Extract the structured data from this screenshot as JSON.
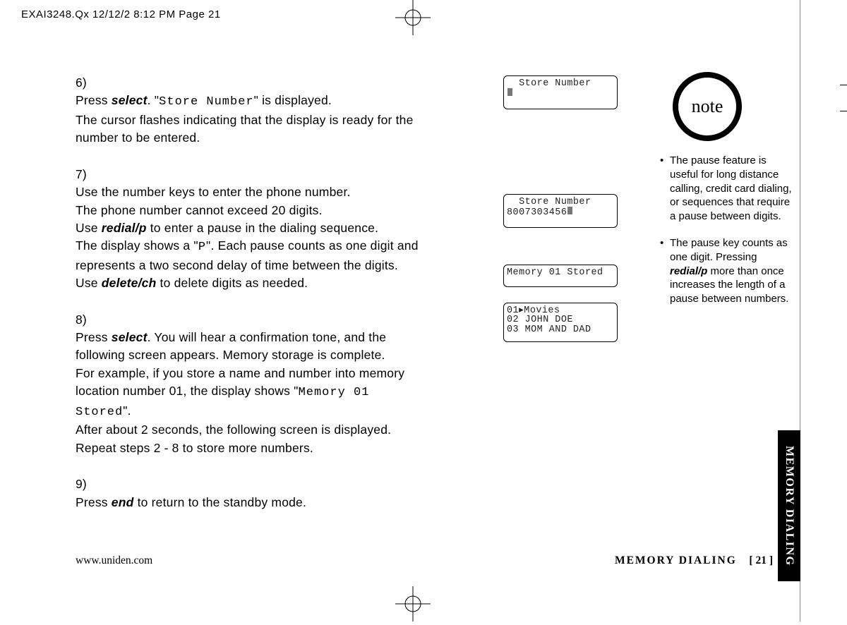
{
  "header": {
    "slug": "EXAI3248.Qx  12/12/2 8:12 PM  Page 21"
  },
  "steps": {
    "s6": {
      "num": "6)",
      "l1a": "Press ",
      "l1b": "select",
      "l1c": ". \"",
      "l1d": "Store Number",
      "l1e": "\" is displayed.",
      "l2": "The cursor flashes indicating that the display is ready for the number to be entered."
    },
    "s7": {
      "num": "7)",
      "l1": "Use the number keys to enter the phone number.",
      "l2": "The phone number cannot exceed 20 digits.",
      "l3a": "Use ",
      "l3b": "redial/p",
      "l3c": " to enter a pause in the dialing sequence.",
      "l4a": "The display shows a \"",
      "l4b": "P",
      "l4c": "\". Each pause counts as one digit and represents a two second delay of time between the digits.",
      "l5a": "Use ",
      "l5b": "delete/ch",
      "l5c": " to delete digits as needed."
    },
    "s8": {
      "num": "8)",
      "l1a": "Press ",
      "l1b": "select",
      "l1c": ". You will hear a confirmation tone, and the following screen appears. Memory storage is complete.",
      "l2a": "For example, if you store a name and number into memory location number 01, the display shows \"",
      "l2b": "Memory 01 Stored",
      "l2c": "\".",
      "l3": "After about 2 seconds, the following screen is displayed. Repeat steps 2 - 8 to store more numbers."
    },
    "s9": {
      "num": "9)",
      "l1a": "Press ",
      "l1b": "end",
      "l1c": " to return to the standby mode."
    }
  },
  "lcd": {
    "screen1_line1": "  Store Number",
    "screen2_line1": "  Store Number",
    "screen2_line2": "8007303456",
    "screen3_line1": "Memory 01 Stored",
    "screen4_line1": "01▸Movies",
    "screen4_line2": "02 JOHN DOE",
    "screen4_line3": "03 MOM AND DAD"
  },
  "note": {
    "icon_label": "note",
    "b1": "The pause feature is useful for long distance calling, credit card dialing, or sequences that require a pause between digits.",
    "b2a": "The pause key counts as one digit. Pressing ",
    "b2b": "redial/p",
    "b2c": "  more than once increases the length of a pause between numbers."
  },
  "footer": {
    "left": "www.uniden.com",
    "right_label": "MEMORY DIALING",
    "right_page": "[ 21 ]"
  },
  "tab": {
    "label": "MEMORY DIALING"
  }
}
